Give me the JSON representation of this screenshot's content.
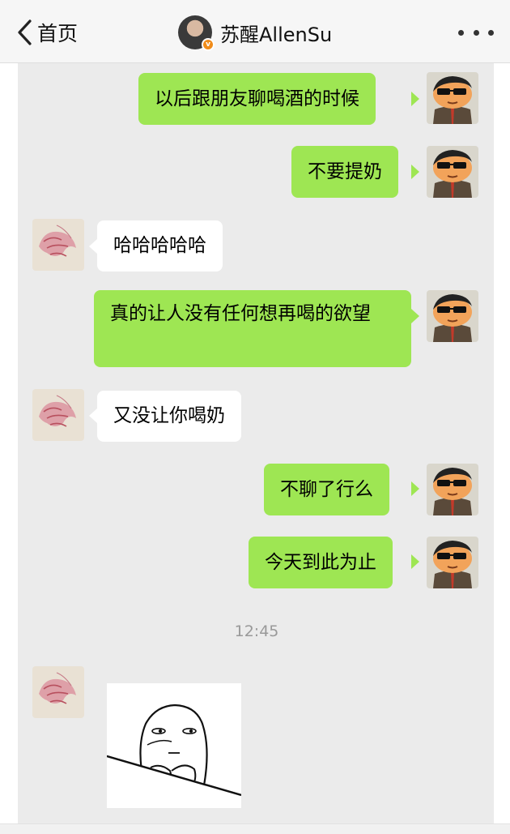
{
  "header": {
    "back_label": "首页",
    "title": "苏醒AllenSu",
    "verified_badge": "v"
  },
  "messages": [
    {
      "sender": "me",
      "text": "以后跟朋友聊喝酒的时候"
    },
    {
      "sender": "me",
      "text": "不要提奶"
    },
    {
      "sender": "them",
      "text": "哈哈哈哈哈"
    },
    {
      "sender": "me",
      "text": "真的让人没有任何想再喝的欲望"
    },
    {
      "sender": "them",
      "text": "又没让你喝奶"
    },
    {
      "sender": "me",
      "text": "不聊了行么"
    },
    {
      "sender": "me",
      "text": "今天到此为止"
    }
  ],
  "timestamp": "12:45",
  "colors": {
    "my_bubble": "#9ee653",
    "their_bubble": "#ffffff",
    "chat_background": "#ebebeb",
    "verified": "#f08c1a"
  },
  "icons": {
    "back": "chevron-left-icon",
    "more": "more-dots-icon",
    "my_avatar": "cartoon-avatar",
    "their_avatar": "sketch-avatar",
    "sticker": "staring-face-sticker"
  }
}
